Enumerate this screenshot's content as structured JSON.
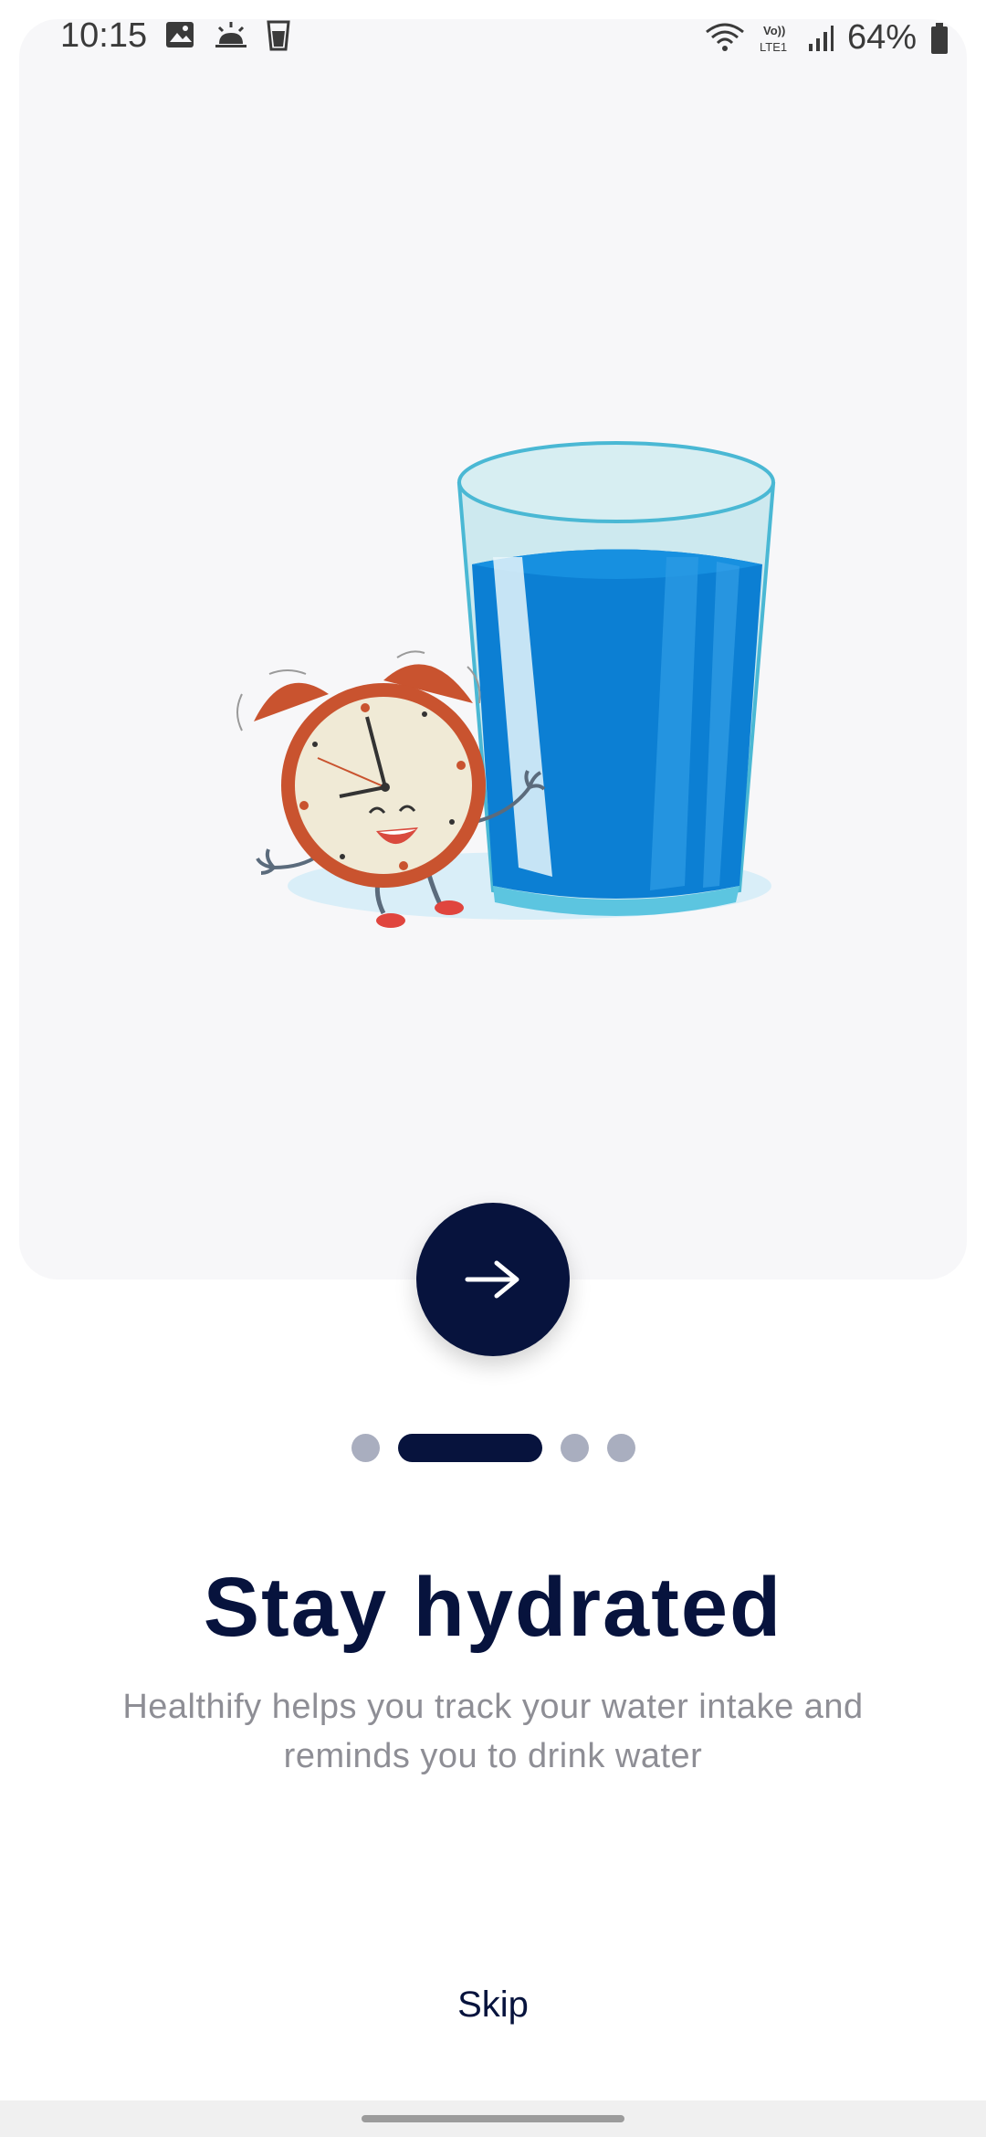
{
  "status_bar": {
    "time": "10:15",
    "battery": "64%",
    "left_icons": [
      "image-icon",
      "weather-icon",
      "cup-icon"
    ],
    "right_icons": [
      "wifi-icon",
      "volte-icon",
      "signal-icon",
      "battery-icon"
    ]
  },
  "illustration": {
    "subject": "alarm clock character leaning on glass of water"
  },
  "next_button": {
    "icon": "arrow-right-icon"
  },
  "pager": {
    "count": 4,
    "active_index": 1
  },
  "content": {
    "title": "Stay hydrated",
    "subtitle": "Healthify helps you track your water intake and reminds you to drink water"
  },
  "skip_label": "Skip",
  "colors": {
    "primary": "#07133d",
    "inactive_dot": "#a9aebf",
    "water": "#0c7fd3",
    "clock": "#c9532f"
  }
}
